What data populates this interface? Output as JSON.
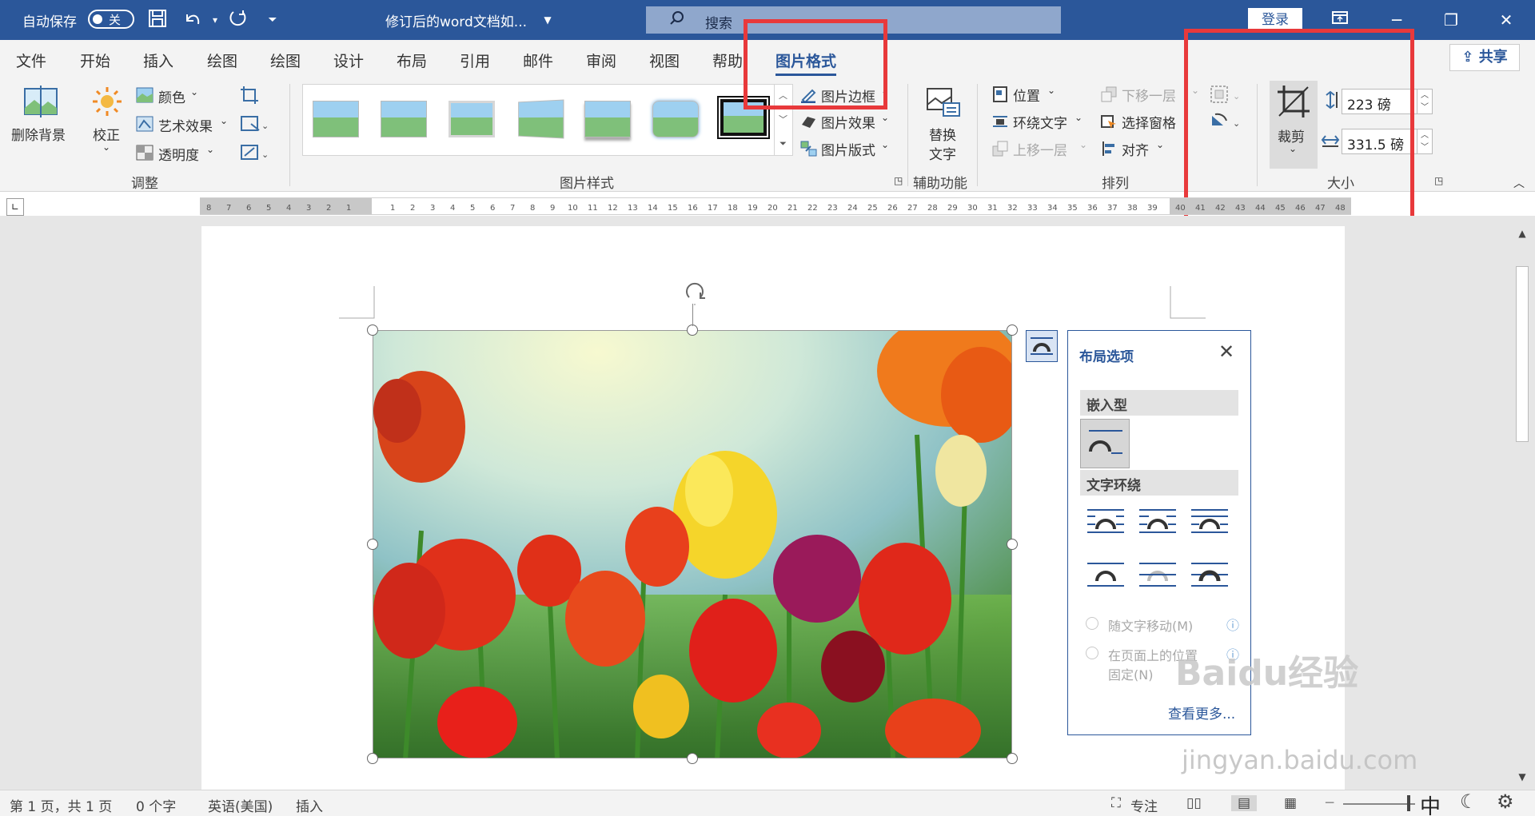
{
  "titlebar": {
    "autosave": "自动保存",
    "toggle": "关",
    "doc_title": "修订后的word文档如...",
    "search": "搜索",
    "login": "登录"
  },
  "tabs": [
    {
      "label": "文件"
    },
    {
      "label": "开始"
    },
    {
      "label": "插入"
    },
    {
      "label": "绘图"
    },
    {
      "label": "绘图"
    },
    {
      "label": "设计"
    },
    {
      "label": "布局"
    },
    {
      "label": "引用"
    },
    {
      "label": "邮件"
    },
    {
      "label": "审阅"
    },
    {
      "label": "视图"
    },
    {
      "label": "帮助"
    },
    {
      "label": "图片格式"
    }
  ],
  "share": "共享",
  "ribbon": {
    "remove_bg": "删除背景",
    "correct": "校正",
    "color": "颜色",
    "artistic": "艺术效果",
    "transparency": "透明度",
    "group_adjust": "调整",
    "border": "图片边框",
    "effects": "图片效果",
    "layout": "图片版式",
    "group_styles": "图片样式",
    "alt_text_1": "替换",
    "alt_text_2": "文字",
    "group_access": "辅助功能",
    "position": "位置",
    "wrap": "环绕文字",
    "bring_forward": "上移一层",
    "send_backward": "下移一层",
    "select_pane": "选择窗格",
    "align": "对齐",
    "group_arrange": "排列",
    "crop": "裁剪",
    "height": "223 磅",
    "width": "331.5 磅",
    "group_size": "大小"
  },
  "layout_panel": {
    "title": "布局选项",
    "inline": "嵌入型",
    "wrap": "文字环绕",
    "move_with_text": "随文字移动(M)",
    "fix_pos_1": "在页面上的位置",
    "fix_pos_2": "固定(N)",
    "see_more": "查看更多..."
  },
  "status": {
    "page": "第 1 页，共 1 页",
    "words": "0 个字",
    "lang": "英语(美国)",
    "insert": "插入",
    "focus": "专注",
    "ime": "中"
  },
  "watermark": {
    "brand": "Baidu经验",
    "url": "jingyan.baidu.com"
  },
  "colors": {
    "accent": "#2b579a",
    "highlight_box": "#e8393b"
  }
}
